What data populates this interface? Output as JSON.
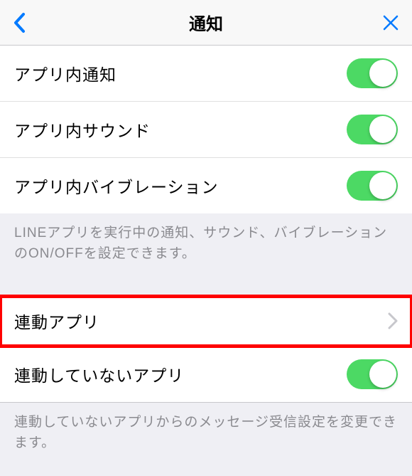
{
  "header": {
    "title": "通知"
  },
  "section1": {
    "rows": [
      {
        "label": "アプリ内通知",
        "on": true
      },
      {
        "label": "アプリ内サウンド",
        "on": true
      },
      {
        "label": "アプリ内バイブレーション",
        "on": true
      }
    ],
    "footer": "LINEアプリを実行中の通知、サウンド、バイブレーションのON/OFFを設定できます。"
  },
  "section2": {
    "linked_apps_label": "連動アプリ",
    "unlinked_apps_label": "連動していないアプリ",
    "unlinked_apps_on": true,
    "footer": "連動していないアプリからのメッセージ受信設定を変更できます。"
  },
  "colors": {
    "accent_blue": "#007aff",
    "toggle_green": "#4cd964",
    "highlight_red": "#ff0000"
  }
}
